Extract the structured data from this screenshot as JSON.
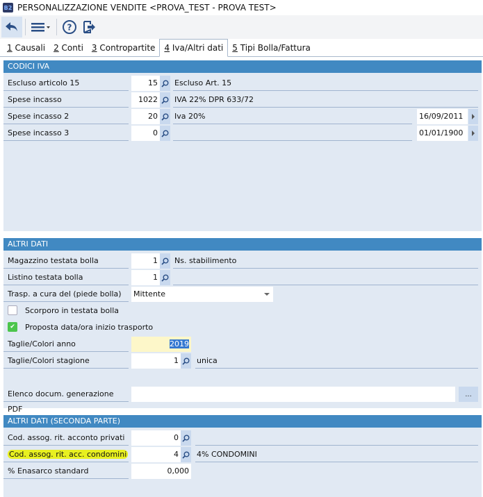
{
  "window": {
    "title": "PERSONALIZZAZIONE VENDITE <PROVA_TEST - PROVA TEST>",
    "app_icon": "B2"
  },
  "toolbar": {
    "icons": [
      "undo-arrow-icon",
      "menu-icon",
      "help-icon",
      "exit-icon"
    ]
  },
  "tabs": [
    {
      "key": "1",
      "label": " Causali"
    },
    {
      "key": "2",
      "label": " Conti"
    },
    {
      "key": "3",
      "label": " Contropartite"
    },
    {
      "key": "4",
      "label": " Iva/Altri dati",
      "selected": true
    },
    {
      "key": "5",
      "label": " Tipi Bolla/Fattura"
    }
  ],
  "codici_iva": {
    "title": "CODICI IVA",
    "rows": [
      {
        "label": "Escluso articolo 15",
        "value": "15",
        "desc": "Escluso Art. 15"
      },
      {
        "label": "Spese incasso",
        "value": "1022",
        "desc": "IVA 22% DPR 633/72"
      },
      {
        "label": "Spese incasso 2",
        "value": "20",
        "desc": "Iva 20%",
        "date": "16/09/2011"
      },
      {
        "label": "Spese incasso 3",
        "value": "0",
        "desc": "",
        "date": "01/01/1900"
      }
    ]
  },
  "altri_dati": {
    "title": "ALTRI DATI",
    "magazzino": {
      "label": "Magazzino testata bolla",
      "value": "1",
      "desc": "Ns. stabilimento"
    },
    "listino": {
      "label": "Listino testata bolla",
      "value": "1",
      "desc": ""
    },
    "trasporto": {
      "label": "Trasp. a cura del (piede bolla)",
      "value": "Mittente"
    },
    "scorporo": {
      "label": "Scorporo in testata bolla",
      "checked": false
    },
    "proposta": {
      "label": "Proposta data/ora inizio trasporto",
      "checked": true
    },
    "anno": {
      "label": "Taglie/Colori anno",
      "value": "2019"
    },
    "stagione": {
      "label": "Taglie/Colori stagione",
      "value": "1",
      "desc": "unica"
    },
    "pdf": {
      "label": "Elenco docum. generazione PDF",
      "value": "",
      "button": "..."
    }
  },
  "seconda_parte": {
    "title": "ALTRI DATI (SECONDA PARTE)",
    "privati": {
      "label": "Cod. assog. rit. acconto privati",
      "value": "0",
      "desc": ""
    },
    "condomini": {
      "label": "Cod. assog. rit. acc. condomini",
      "value": "4",
      "desc": "4% CONDOMINI"
    },
    "enasarco": {
      "label": "% Enasarco standard",
      "value": "0,000"
    }
  }
}
